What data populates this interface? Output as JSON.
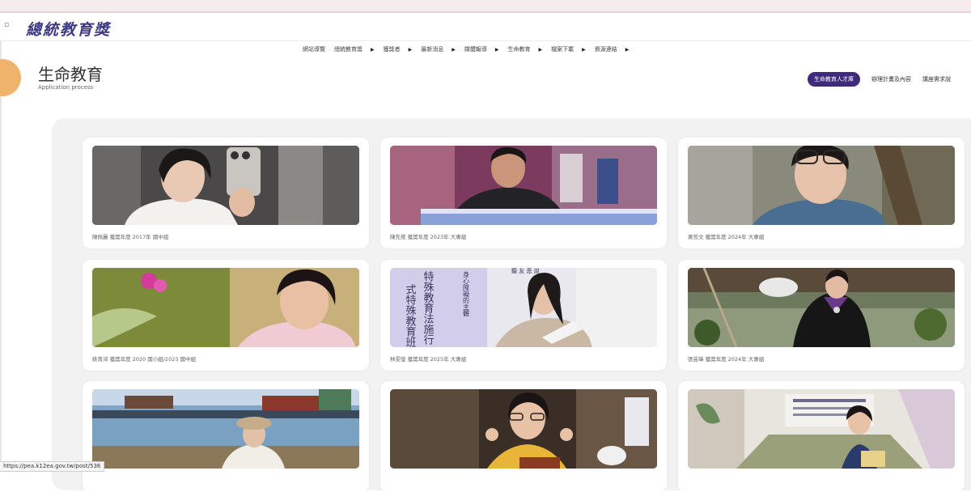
{
  "site": {
    "logo_text": "總統教育獎",
    "logo_mark": "▫"
  },
  "nav": {
    "items": [
      {
        "label": "網站導覽",
        "caret": ""
      },
      {
        "label": "總統教育獎",
        "caret": "▶"
      },
      {
        "label": "獲獎者",
        "caret": "▶"
      },
      {
        "label": "最新消息",
        "caret": "▶"
      },
      {
        "label": "媒體報導",
        "caret": "▶"
      },
      {
        "label": "生命教育",
        "caret": "▶"
      },
      {
        "label": "檔案下載",
        "caret": "▶"
      },
      {
        "label": "資源連結",
        "caret": "▶"
      }
    ]
  },
  "page": {
    "title": "生命教育",
    "subtitle": "Application process"
  },
  "tabs": [
    {
      "label": "生命教育人才庫",
      "active": true
    },
    {
      "label": "辦理計畫及內容",
      "active": false
    },
    {
      "label": "講座需求說",
      "active": false
    }
  ],
  "cards": [
    {
      "caption": "陳佩麗 獲獎年度 2017年 國中組"
    },
    {
      "caption": "陳先覺 獲獎年度 2023年 大專組"
    },
    {
      "caption": "黃哲文 獲獎年度 2024年 大專組"
    },
    {
      "caption": "姚育沛 獲獎年度 2020 國小組/2023 國中組"
    },
    {
      "caption": "林雯瑩 獲獎年度 2025年 大專組"
    },
    {
      "caption": "張芸瑋 獲獎年度 2024年 大專組"
    },
    {
      "caption": ""
    },
    {
      "caption": ""
    },
    {
      "caption": ""
    }
  ],
  "board_text": {
    "left_lines": [
      "式特殊教育班",
      "特殊教育法施行"
    ],
    "side_line": "身心障礙的主體",
    "top_line": "聽 友 悲 說"
  },
  "status_bar": {
    "url": "https://pea.k12ea.gov.tw/post/536"
  },
  "colors": {
    "brand_purple": "#3f2a7c",
    "accent_orange": "#f0b36b",
    "panel_gray": "#f2f2f3"
  }
}
